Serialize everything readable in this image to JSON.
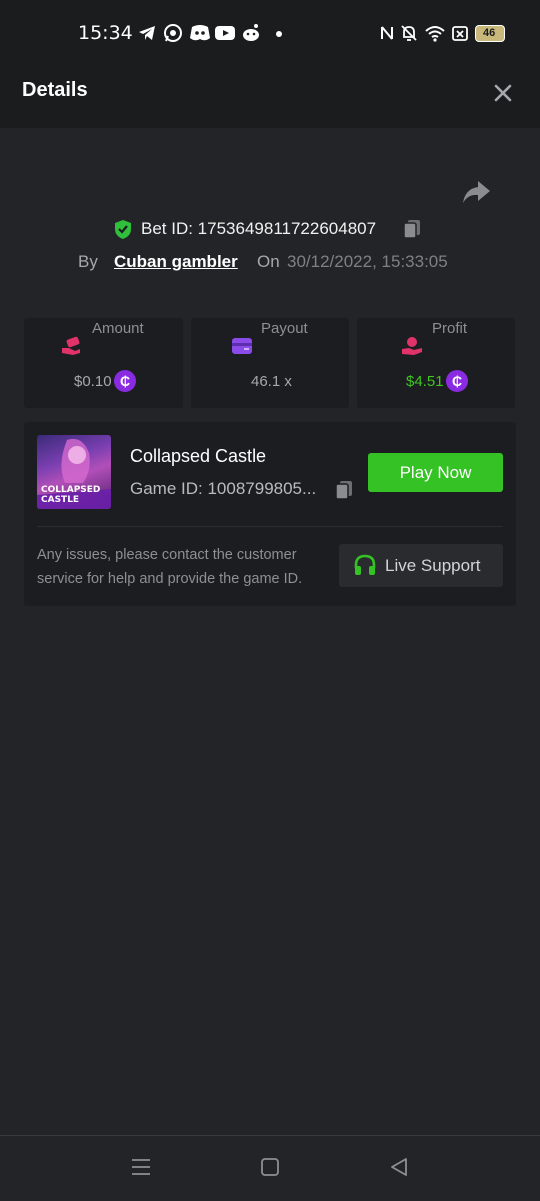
{
  "status_bar": {
    "time": "15:34",
    "battery": "46",
    "icons": [
      "telegram-icon",
      "whatsapp-icon",
      "discord-icon",
      "youtube-icon",
      "reddit-icon",
      "dot-icon",
      "nfc-icon",
      "bell-off-icon",
      "wifi-icon",
      "sim-x-icon",
      "battery-icon"
    ]
  },
  "header": {
    "title": "Details",
    "close_icon": "close-icon"
  },
  "bet": {
    "share_icon": "share-icon",
    "bet_id_label": "Bet ID: 1753649811722604807",
    "by_label": "By",
    "user": "Cuban gambler",
    "on_label": "On",
    "datetime": "30/12/2022, 15:33:05"
  },
  "stats": [
    {
      "label": "Amount",
      "value": "$0.10",
      "icon": "hand-coin-icon",
      "coin": "₵"
    },
    {
      "label": "Payout",
      "value": "46.1 x",
      "icon": "card-icon"
    },
    {
      "label": "Profit",
      "value": "$4.51",
      "icon": "profit-hand-icon",
      "coin": "₵"
    }
  ],
  "game": {
    "thumb_text_1": "COLLAPSED",
    "thumb_text_2": "CASTLE",
    "name": "Collapsed Castle",
    "game_id": "Game ID: 1008799805...",
    "play_label": "Play Now",
    "issue_text": "Any issues, please contact the customer service for help and provide the game ID.",
    "support_label": "Live Support"
  },
  "colors": {
    "accent_green": "#35c224",
    "profit_green": "#3ec61f",
    "coin_purple": "#8a2be2",
    "background": "#232427",
    "card": "#1c1d20"
  }
}
